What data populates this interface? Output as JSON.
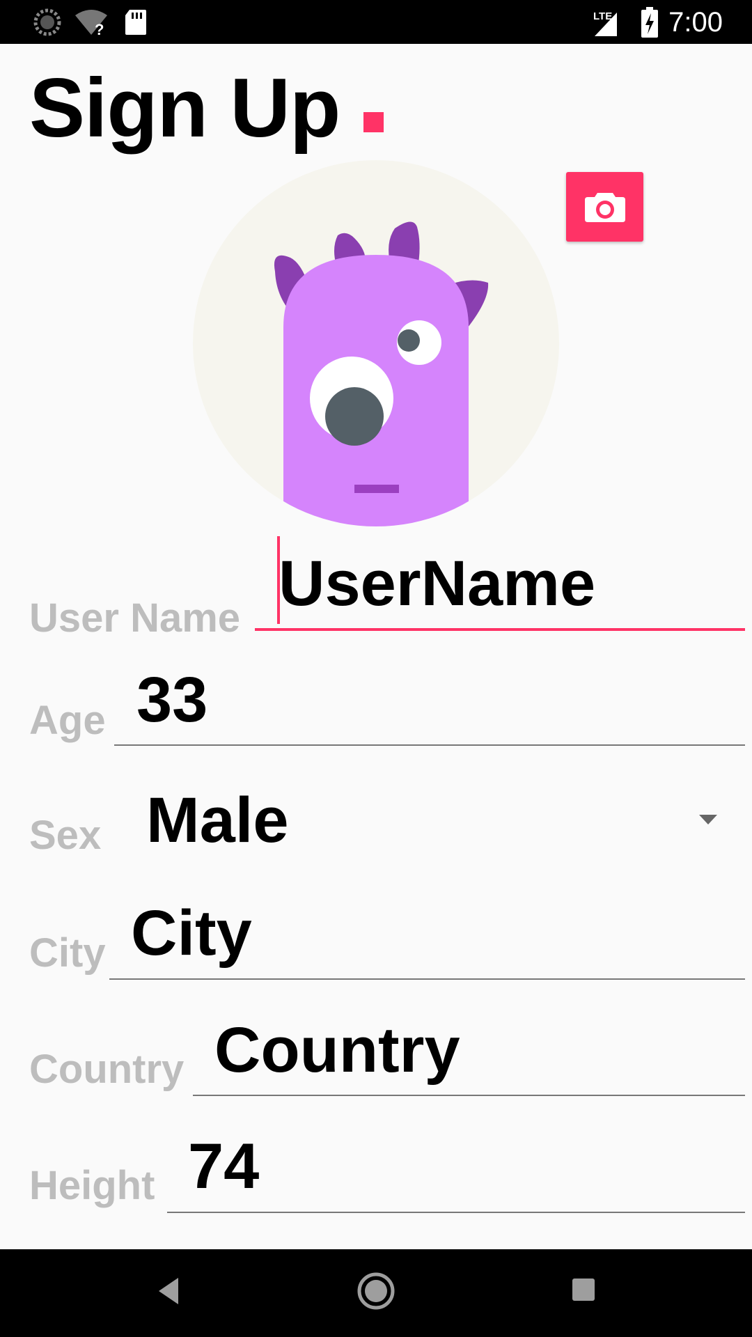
{
  "status_bar": {
    "time": "7:00",
    "network": "LTE",
    "icons": [
      "sync-icon",
      "wifi-unknown-icon",
      "sd-card-icon",
      "lte-signal-icon",
      "battery-charging-icon"
    ]
  },
  "page": {
    "title": "Sign Up",
    "accent_color": "#ff3366"
  },
  "avatar": {
    "icon": "monster-avatar",
    "camera_icon": "camera-icon"
  },
  "form": {
    "username": {
      "label": "User Name",
      "value": "UserName",
      "focused": true
    },
    "age": {
      "label": "Age",
      "value": "33"
    },
    "sex": {
      "label": "Sex",
      "value": "Male"
    },
    "city": {
      "label": "City",
      "value": "City"
    },
    "country": {
      "label": "Country",
      "value": "Country"
    },
    "height": {
      "label": "Height",
      "value": "74"
    }
  },
  "nav_bar": {
    "icons": [
      "back-icon",
      "home-icon",
      "recents-icon"
    ]
  }
}
